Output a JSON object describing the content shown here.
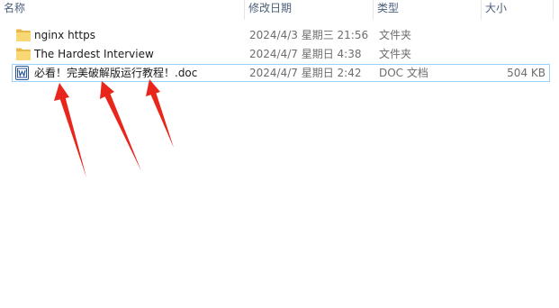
{
  "columns": {
    "name": "名称",
    "date": "修改日期",
    "type": "类型",
    "size": "大小"
  },
  "files": [
    {
      "name": "nginx https",
      "date": "2024/4/3 星期三 21:56",
      "type": "文件夹",
      "size": "",
      "icon": "folder-icon"
    },
    {
      "name": "The Hardest Interview",
      "date": "2024/4/7 星期日 4:38",
      "type": "文件夹",
      "size": "",
      "icon": "folder-icon"
    },
    {
      "name": "必看！完美破解版运行教程！.doc",
      "date": "2024/4/7 星期日 2:42",
      "type": "DOC 文档",
      "size": "504 KB",
      "icon": "word-doc-icon"
    }
  ],
  "colors": {
    "header_text": "#4c607a",
    "selection_border": "#99d1ff",
    "arrow": "#e8261c",
    "folder": "#f8d775"
  }
}
